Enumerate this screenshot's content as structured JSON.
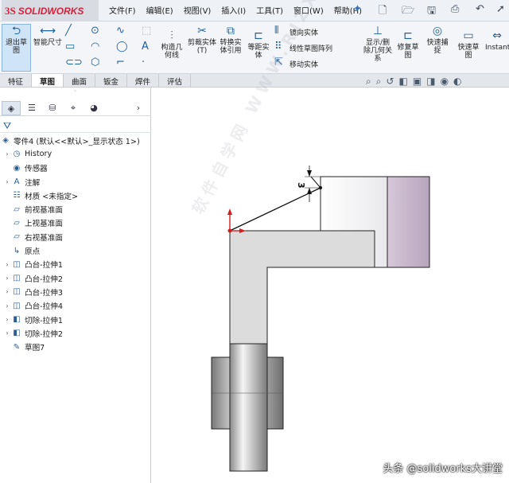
{
  "logo": {
    "prefix": "3S",
    "name": "SOLIDWORKS"
  },
  "menu": [
    "文件(F)",
    "编辑(E)",
    "视图(V)",
    "插入(I)",
    "工具(T)",
    "窗口(W)",
    "帮助(H)"
  ],
  "ribbon": {
    "exit_sketch": "退出草图",
    "smart_dimension": "智能尺寸",
    "convert_geometry": "构造几何线",
    "trim_entities": "剪裁实体(T)",
    "convert_entities": "转换实体引用",
    "offset_entities": "等距实体",
    "mirror_entities": "镜向实体",
    "linear_pattern": "线性草图阵列",
    "move_entities": "移动实体",
    "display_relations": "显示/删除几何关系",
    "repair_sketch": "修复草图",
    "quick_snaps": "快速捕捉",
    "rapid_sketch": "快速草图",
    "instant2d": "Instant2"
  },
  "tabs": [
    {
      "label": "特征",
      "active": false
    },
    {
      "label": "草图",
      "active": true
    },
    {
      "label": "曲面",
      "active": false
    },
    {
      "label": "钣金",
      "active": false
    },
    {
      "label": "焊件",
      "active": false
    },
    {
      "label": "评估",
      "active": false
    }
  ],
  "tree": {
    "root": "零件4 (默认<<默认>_显示状态 1>)",
    "items": [
      {
        "label": "History",
        "icon": "history-icon",
        "glyph": "◷",
        "expand": true
      },
      {
        "label": "传感器",
        "icon": "sensor-icon",
        "glyph": "◉",
        "expand": false
      },
      {
        "label": "注解",
        "icon": "annotation-icon",
        "glyph": "A",
        "expand": true
      },
      {
        "label": "材质 <未指定>",
        "icon": "material-icon",
        "glyph": "☷",
        "expand": false
      },
      {
        "label": "前视基准面",
        "icon": "plane-icon",
        "glyph": "▱",
        "expand": false
      },
      {
        "label": "上视基准面",
        "icon": "plane-icon",
        "glyph": "▱",
        "expand": false
      },
      {
        "label": "右视基准面",
        "icon": "plane-icon",
        "glyph": "▱",
        "expand": false
      },
      {
        "label": "原点",
        "icon": "origin-icon",
        "glyph": "↳",
        "expand": false
      },
      {
        "label": "凸台-拉伸1",
        "icon": "extrude-icon",
        "glyph": "◫",
        "expand": true
      },
      {
        "label": "凸台-拉伸2",
        "icon": "extrude-icon",
        "glyph": "◫",
        "expand": true
      },
      {
        "label": "凸台-拉伸3",
        "icon": "extrude-icon",
        "glyph": "◫",
        "expand": true
      },
      {
        "label": "凸台-拉伸4",
        "icon": "extrude-icon",
        "glyph": "◫",
        "expand": true
      },
      {
        "label": "切除-拉伸1",
        "icon": "cut-extrude-icon",
        "glyph": "◧",
        "expand": true
      },
      {
        "label": "切除-拉伸2",
        "icon": "cut-extrude-icon",
        "glyph": "◧",
        "expand": true
      },
      {
        "label": "草图7",
        "icon": "sketch-icon",
        "glyph": "✎",
        "expand": false
      }
    ]
  },
  "dimension_value": "3",
  "watermark": "软件自学网 WWW.RJZXW.COM",
  "credit": "头条 @solidworks大讲堂",
  "colors": {
    "accent": "#1f5f9a",
    "part_face": "#dcdcdc",
    "logo_red": "#d4213d"
  }
}
